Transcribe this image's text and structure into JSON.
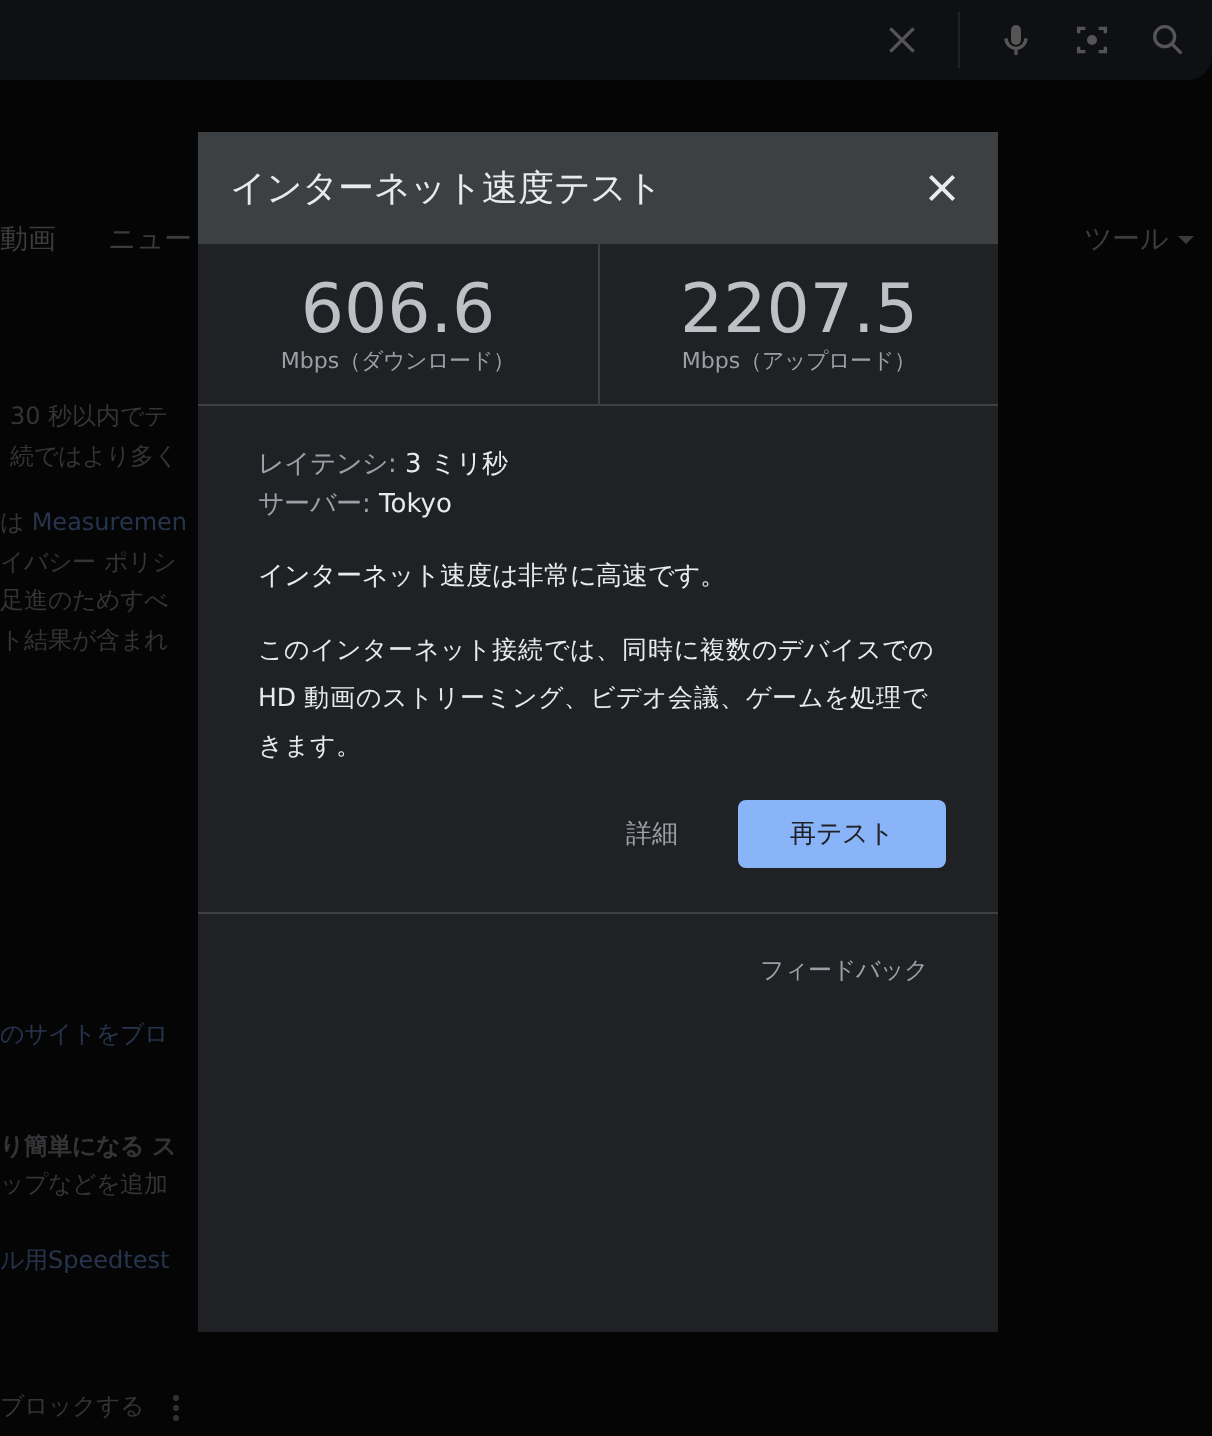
{
  "tabs": [
    {
      "label": "動画",
      "selected": false
    },
    {
      "label": "ニュー",
      "selected": false
    }
  ],
  "tools_menu": {
    "label": "ツール"
  },
  "results": [
    {
      "lines": [
        {
          "text": "30 秒以内でテ",
          "kind": "plain"
        },
        {
          "text": "続ではより多く",
          "kind": "plain"
        }
      ]
    },
    {
      "lines": [
        {
          "text": "は **Measuremen**",
          "kind": "plain"
        },
        {
          "text": "イバシー ポリシ",
          "kind": "plain"
        },
        {
          "text": "足進のためすべ",
          "kind": "plain"
        },
        {
          "text": "ト結果が含まれ",
          "kind": "plain"
        }
      ]
    },
    {
      "lines": [
        {
          "text": "のサイトをブロ",
          "kind": "link"
        }
      ]
    },
    {
      "lines": [
        {
          "text": "り簡単になる ス",
          "kind": "bold"
        },
        {
          "text": "ップなどを追加",
          "kind": "plain"
        }
      ]
    },
    {
      "lines": [
        {
          "text": "ル用Speedtest",
          "kind": "link"
        }
      ]
    },
    {
      "lines": [
        {
          "text": "ブロックする",
          "kind": "plain"
        }
      ]
    }
  ],
  "dialog": {
    "title": "インターネット速度テスト",
    "stats": [
      {
        "value": "606.6",
        "unit": "Mbps（ダウンロード）"
      },
      {
        "value": "2207.5",
        "unit": "Mbps（アップロード）"
      }
    ],
    "details": [
      {
        "label": "レイテンシ:",
        "value": "3 ミリ秒"
      },
      {
        "label": "サーバー:",
        "value": "Tokyo"
      }
    ],
    "verdict": "インターネット速度は非常に高速です。",
    "description": "このインターネット接続では、同時に複数のデバイスでの HD 動画のストリーミング、ビデオ会議、ゲームを処理できます。",
    "details_button": "詳細",
    "retest_button": "再テスト",
    "feedback": "フィードバック"
  }
}
